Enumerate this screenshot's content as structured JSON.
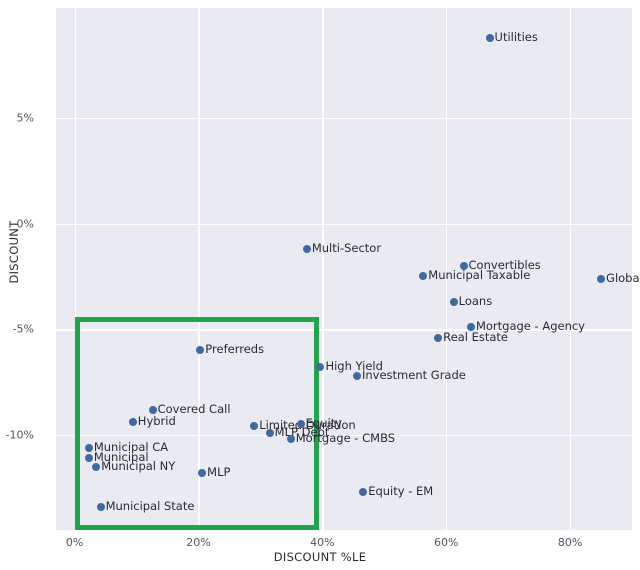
{
  "chart_data": {
    "type": "scatter",
    "title": "",
    "xlabel": "DISCOUNT %LE",
    "ylabel": "DISCOUNT",
    "xlim": [
      -3,
      90
    ],
    "ylim": [
      -14.5,
      10.2
    ],
    "xticks": [
      "0%",
      "20%",
      "40%",
      "60%",
      "80%"
    ],
    "xtick_values": [
      0,
      20,
      40,
      60,
      80
    ],
    "yticks": [
      "5%",
      "0%",
      "-5%",
      "-10%"
    ],
    "ytick_values": [
      5,
      0,
      -5,
      -10
    ],
    "grid": true,
    "legend": "none",
    "marker_color": "#41699f",
    "plot_bg": "#eaeaf2",
    "grid_color": "#ffffff",
    "points": [
      {
        "label": "Utilities",
        "x": 67.0,
        "y": 8.8
      },
      {
        "label": "Multi-Sector",
        "x": 37.5,
        "y": -1.2
      },
      {
        "label": "Convertibles",
        "x": 62.8,
        "y": -2.0
      },
      {
        "label": "Municipal Taxable",
        "x": 56.3,
        "y": -2.5
      },
      {
        "label": "Global Income",
        "x": 85.0,
        "y": -2.6
      },
      {
        "label": "Loans",
        "x": 61.2,
        "y": -3.7
      },
      {
        "label": "Mortgage - Agency",
        "x": 64.0,
        "y": -4.9
      },
      {
        "label": "Real Estate",
        "x": 58.7,
        "y": -5.4
      },
      {
        "label": "Preferreds",
        "x": 20.3,
        "y": -6.0
      },
      {
        "label": "High Yield",
        "x": 39.7,
        "y": -6.8
      },
      {
        "label": "Investment Grade",
        "x": 45.6,
        "y": -7.2
      },
      {
        "label": "Covered Call",
        "x": 12.6,
        "y": -8.8
      },
      {
        "label": "Hybrid",
        "x": 9.4,
        "y": -9.4
      },
      {
        "label": "Limited Duration",
        "x": 29.0,
        "y": -9.6
      },
      {
        "label": "Equity",
        "x": 36.5,
        "y": -9.5
      },
      {
        "label": "MLP Debt",
        "x": 31.5,
        "y": -9.9
      },
      {
        "label": "Mortgage - CMBS",
        "x": 34.9,
        "y": -10.2
      },
      {
        "label": "Municipal CA",
        "x": 2.3,
        "y": -10.6
      },
      {
        "label": "Municipal",
        "x": 2.3,
        "y": -11.1
      },
      {
        "label": "Municipal NY",
        "x": 3.5,
        "y": -11.5
      },
      {
        "label": "MLP",
        "x": 20.6,
        "y": -11.8
      },
      {
        "label": "Equity - EM",
        "x": 46.6,
        "y": -12.7
      },
      {
        "label": "Municipal State",
        "x": 4.2,
        "y": -13.4
      }
    ],
    "highlight_region": {
      "color": "#22a44b",
      "x_start": 0,
      "x_end": 39.5,
      "y_top": -4.4,
      "y_bottom": -14.5
    }
  }
}
